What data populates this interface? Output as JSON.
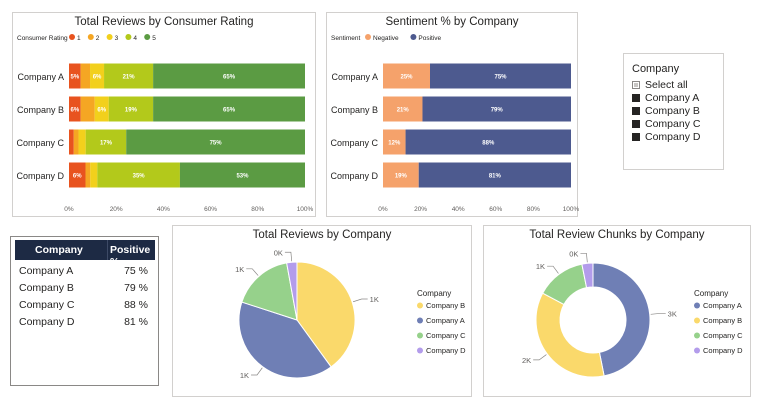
{
  "colors": {
    "rating": [
      "#e8531f",
      "#f5a623",
      "#f2d01c",
      "#b3c91b",
      "#5b9b43"
    ],
    "negative": "#f5a26b",
    "positive": "#4d5a8f",
    "pie": [
      "#fad96b",
      "#6f7fb5",
      "#96d18b",
      "#b39ceb"
    ],
    "table_header": "#1d2a44"
  },
  "rating_chart": {
    "title": "Total Reviews by Consumer Rating",
    "legend_title": "Consumer Rating",
    "legend": [
      "1",
      "2",
      "3",
      "4",
      "5"
    ],
    "x_ticks": [
      "0%",
      "20%",
      "40%",
      "60%",
      "80%",
      "100%"
    ]
  },
  "sentiment_chart": {
    "title": "Sentiment % by Company",
    "legend_title": "Sentiment",
    "legend": [
      "Negative",
      "Positive"
    ],
    "x_ticks": [
      "0%",
      "20%",
      "40%",
      "60%",
      "80%",
      "100%"
    ]
  },
  "slicer": {
    "title": "Company",
    "items": [
      {
        "label": "Select all",
        "state": "partial"
      },
      {
        "label": "Company A",
        "state": "checked"
      },
      {
        "label": "Company B",
        "state": "checked"
      },
      {
        "label": "Company C",
        "state": "checked"
      },
      {
        "label": "Company D",
        "state": "checked"
      }
    ]
  },
  "table": {
    "headers": [
      "Company",
      "Positive %"
    ],
    "rows": [
      [
        "Company A",
        "75 %"
      ],
      [
        "Company B",
        "79 %"
      ],
      [
        "Company C",
        "88 %"
      ],
      [
        "Company D",
        "81 %"
      ]
    ]
  },
  "pie_chart": {
    "title": "Total Reviews by Company",
    "legend_title": "Company",
    "legend": [
      "Company B",
      "Company A",
      "Company C",
      "Company D"
    ]
  },
  "donut_chart": {
    "title": "Total Review Chunks by Company",
    "legend_title": "Company",
    "legend": [
      "Company A",
      "Company B",
      "Company C",
      "Company D"
    ]
  },
  "chart_data": [
    {
      "type": "bar",
      "orientation": "horizontal",
      "stacked": "100%",
      "title": "Total Reviews by Consumer Rating",
      "legend_title": "Consumer Rating",
      "categories": [
        "Company A",
        "Company B",
        "Company C",
        "Company D"
      ],
      "series": [
        {
          "name": "1",
          "values": [
            5,
            5,
            2,
            7
          ]
        },
        {
          "name": "2",
          "values": [
            4,
            6,
            2,
            2
          ]
        },
        {
          "name": "3",
          "values": [
            6,
            6,
            3,
            3
          ]
        },
        {
          "name": "4",
          "values": [
            21,
            19,
            17,
            35
          ]
        },
        {
          "name": "5",
          "values": [
            65,
            65,
            75,
            53
          ]
        }
      ],
      "data_labels": [
        [
          "5%",
          "",
          "6%",
          "21%",
          "65%"
        ],
        [
          "6%",
          "",
          "6%",
          "19%",
          "65%"
        ],
        [
          "",
          "",
          "",
          "17%",
          "75%"
        ],
        [
          "6%",
          "",
          "",
          "35%",
          "53%"
        ]
      ],
      "xlim": [
        0,
        100
      ],
      "x_ticks": [
        "0%",
        "20%",
        "40%",
        "60%",
        "80%",
        "100%"
      ],
      "legend_position": "top-left"
    },
    {
      "type": "bar",
      "orientation": "horizontal",
      "stacked": "100%",
      "title": "Sentiment % by Company",
      "legend_title": "Sentiment",
      "categories": [
        "Company A",
        "Company B",
        "Company C",
        "Company D"
      ],
      "series": [
        {
          "name": "Negative",
          "values": [
            25,
            21,
            12,
            19
          ]
        },
        {
          "name": "Positive",
          "values": [
            75,
            79,
            88,
            81
          ]
        }
      ],
      "data_labels": [
        [
          "25%",
          "75%"
        ],
        [
          "21%",
          "79%"
        ],
        [
          "12%",
          "88%"
        ],
        [
          "19%",
          "81%"
        ]
      ],
      "xlim": [
        0,
        100
      ],
      "x_ticks": [
        "0%",
        "20%",
        "40%",
        "60%",
        "80%",
        "100%"
      ],
      "legend_position": "top-left"
    },
    {
      "type": "pie",
      "title": "Total Reviews by Company",
      "categories": [
        "Company B",
        "Company A",
        "Company C",
        "Company D"
      ],
      "values": [
        1.4,
        1.4,
        0.6,
        0.1
      ],
      "data_labels": [
        "1K",
        "1K",
        "1K",
        "0K"
      ],
      "legend_position": "right"
    },
    {
      "type": "pie",
      "donut": true,
      "title": "Total Review Chunks by Company",
      "categories": [
        "Company A",
        "Company B",
        "Company C",
        "Company D"
      ],
      "values": [
        3.0,
        2.3,
        0.9,
        0.2
      ],
      "data_labels": [
        "3K",
        "2K",
        "1K",
        "0K"
      ],
      "legend_position": "right"
    }
  ]
}
